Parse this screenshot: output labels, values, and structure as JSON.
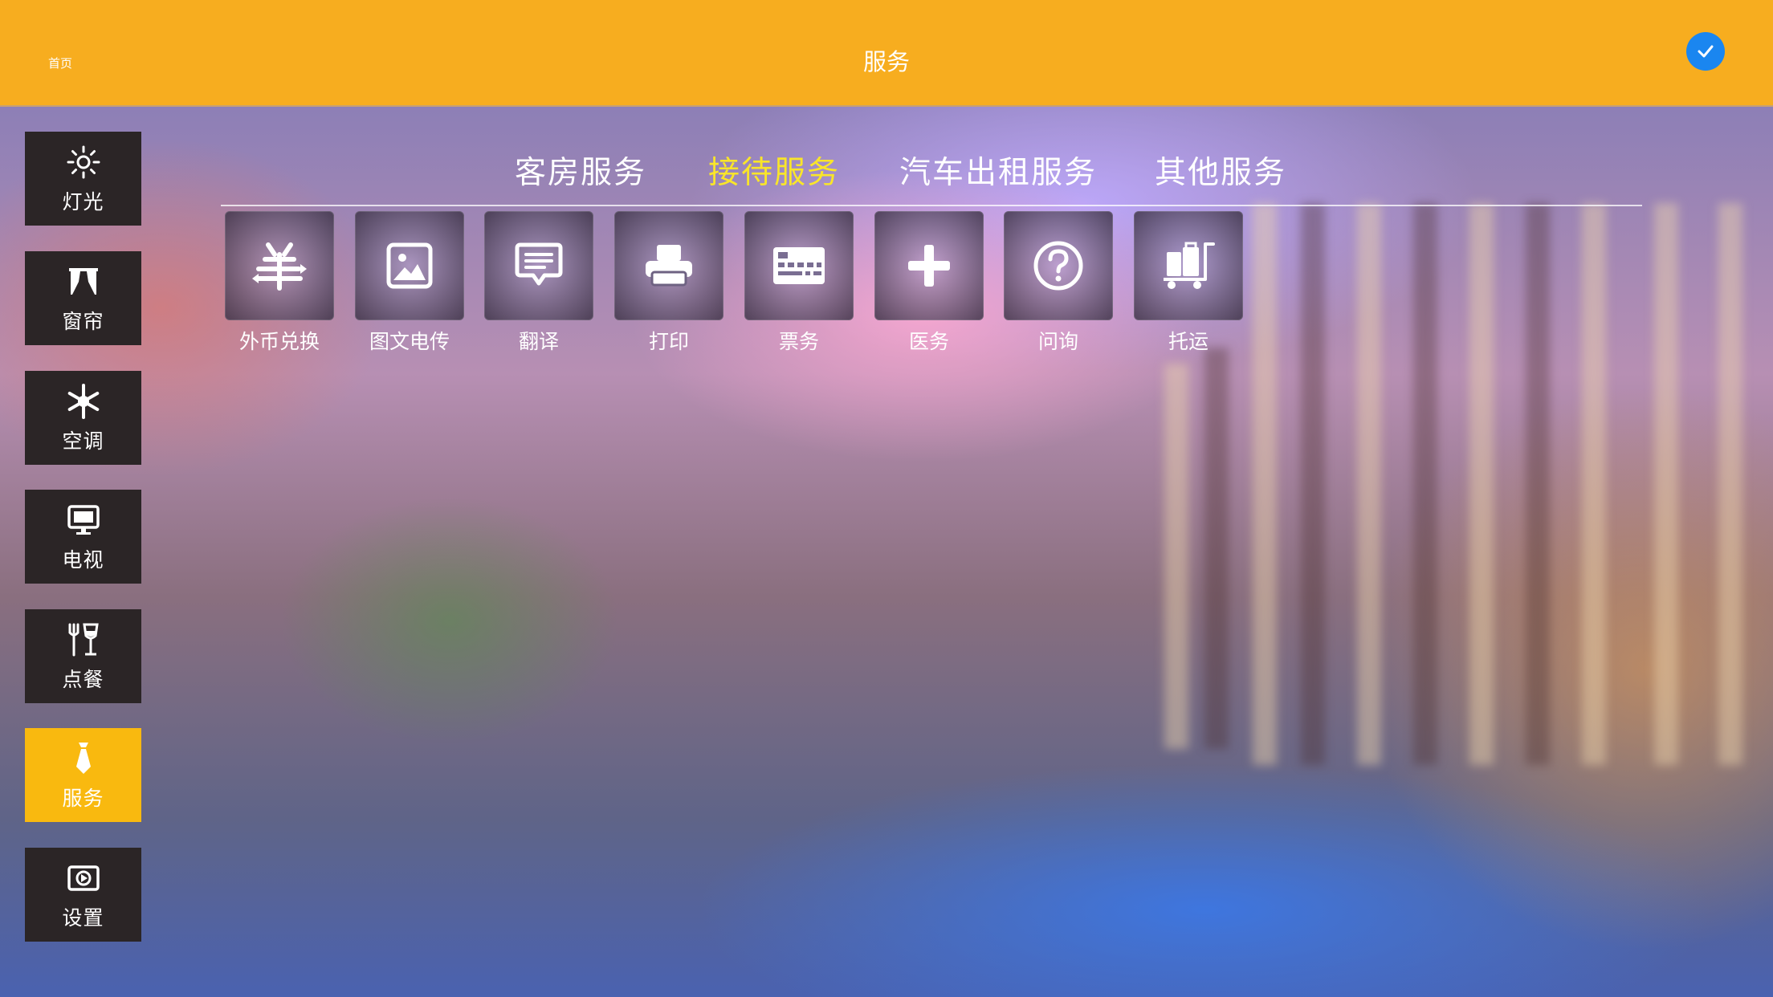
{
  "header": {
    "home_label": "首页",
    "title": "服务",
    "confirm_icon": "checkmark-icon",
    "background_color": "#f7ad1f",
    "confirm_color": "#1a86f0"
  },
  "sidebar": {
    "items": [
      {
        "label": "灯光",
        "icon": "sun-icon",
        "active": false
      },
      {
        "label": "窗帘",
        "icon": "curtain-icon",
        "active": false
      },
      {
        "label": "空调",
        "icon": "snowflake-icon",
        "active": false
      },
      {
        "label": "电视",
        "icon": "monitor-icon",
        "active": false
      },
      {
        "label": "点餐",
        "icon": "fork-glass-icon",
        "active": false
      },
      {
        "label": "服务",
        "icon": "tie-icon",
        "active": true
      },
      {
        "label": "设置",
        "icon": "settings-screen-icon",
        "active": false
      }
    ],
    "active_color": "#f9b90f"
  },
  "tabs": {
    "items": [
      {
        "label": "客房服务",
        "active": false
      },
      {
        "label": "接待服务",
        "active": true
      },
      {
        "label": "汽车出租服务",
        "active": false
      },
      {
        "label": "其他服务",
        "active": false
      }
    ],
    "active_color": "#f9e52a"
  },
  "services": [
    {
      "label": "外币兑换",
      "icon": "currency-exchange-icon"
    },
    {
      "label": "图文电传",
      "icon": "image-icon"
    },
    {
      "label": "翻译",
      "icon": "speech-bubble-icon"
    },
    {
      "label": "打印",
      "icon": "printer-icon"
    },
    {
      "label": "票务",
      "icon": "ticket-icon"
    },
    {
      "label": "医务",
      "icon": "medical-cross-icon"
    },
    {
      "label": "问询",
      "icon": "question-icon"
    },
    {
      "label": "托运",
      "icon": "luggage-cart-icon"
    }
  ]
}
